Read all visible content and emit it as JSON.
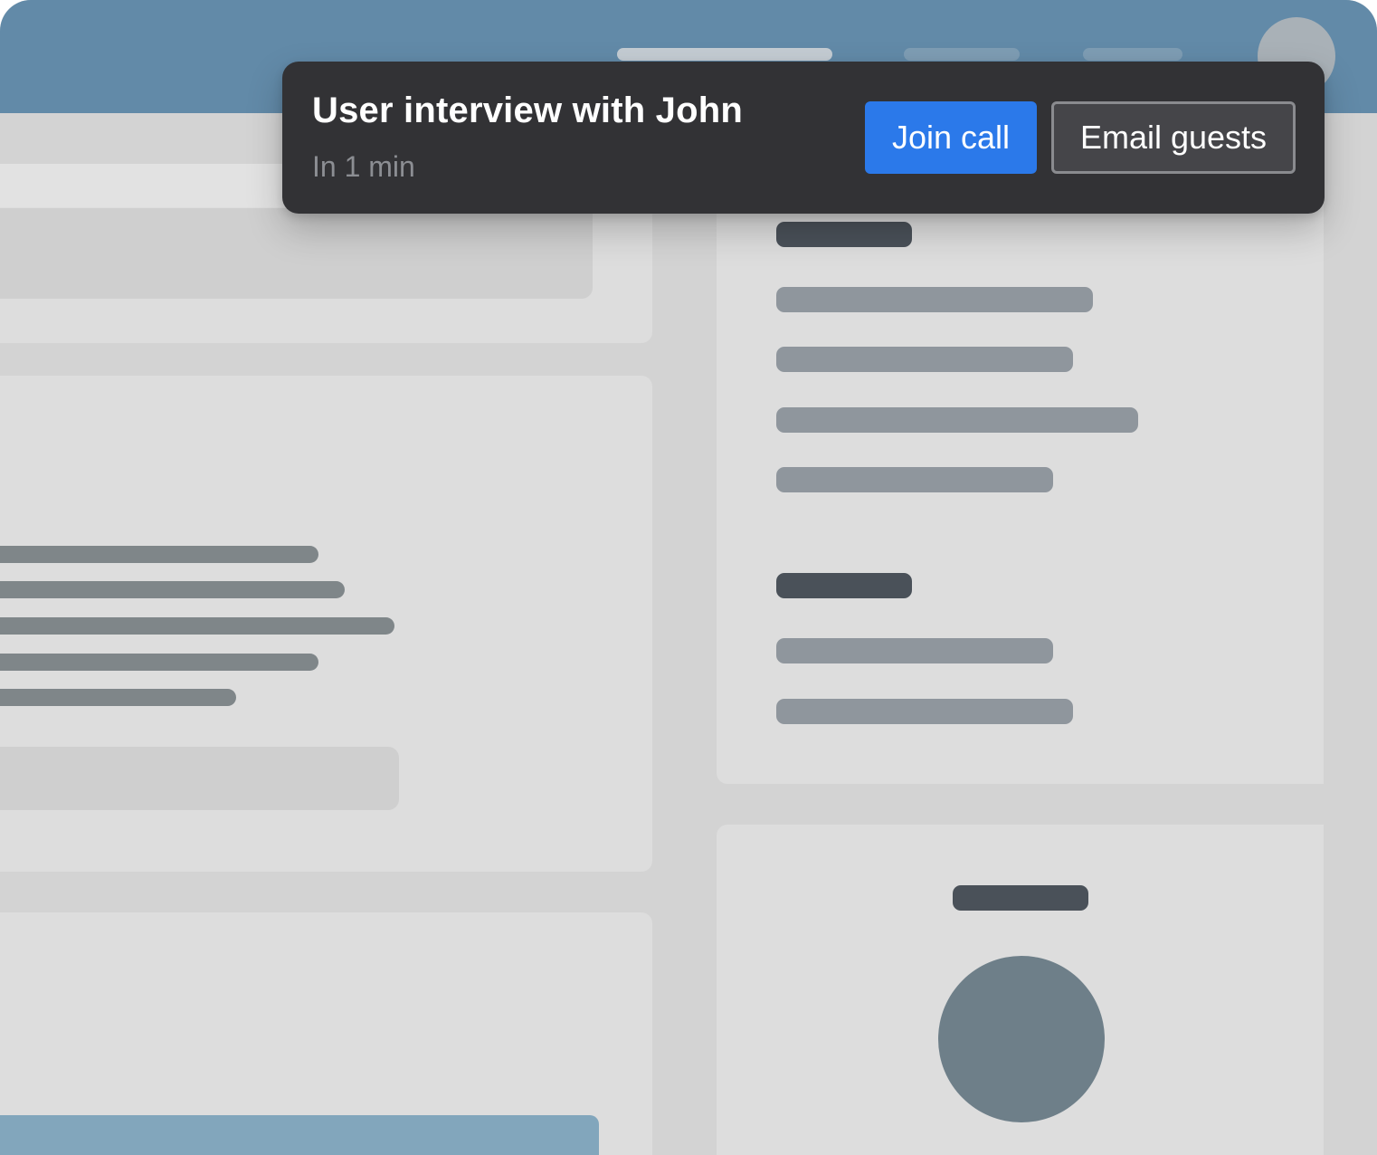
{
  "notification": {
    "title": "User interview with John",
    "subtitle": "In 1 min",
    "primary_action": "Join call",
    "secondary_action": "Email guests"
  },
  "colors": {
    "header": "#628aa8",
    "toast_background": "#323235",
    "primary_button": "#2b79ea",
    "secondary_button": "#454549",
    "subtitle_text": "#8c8e93"
  },
  "icons": {
    "avatar": "user-avatar"
  }
}
